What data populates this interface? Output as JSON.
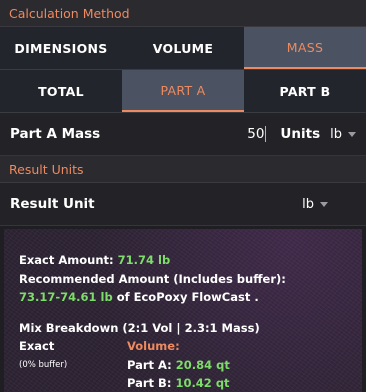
{
  "calc_method": {
    "title": "Calculation Method",
    "tabs": [
      "DIMENSIONS",
      "VOLUME",
      "MASS"
    ],
    "active_tab": "MASS"
  },
  "part_tabs": {
    "tabs": [
      "TOTAL",
      "PART A",
      "PART B"
    ],
    "active_tab": "PART A"
  },
  "part_a_mass": {
    "label": "Part A Mass",
    "value": "50",
    "units_label": "Units",
    "unit": "lb"
  },
  "result_units": {
    "title": "Result Units",
    "label": "Result Unit",
    "unit": "lb"
  },
  "results": {
    "exact_label": "Exact Amount:",
    "exact_value": "71.74 lb",
    "recommended_label": "Recommended Amount (Includes buffer):",
    "recommended_value": "73.17-74.61 lb",
    "product_text": "of EcoPoxy FlowCast .",
    "mix_title": "Mix Breakdown (2:1 Vol | 2.3:1 Mass)",
    "exact_heading": "Exact",
    "buffer_note": "(0% buffer)",
    "volume_heading": "Volume:",
    "part_a_label": "Part A:",
    "part_a_value": "20.84 qt",
    "part_b_label": "Part B:",
    "part_b_value": "10.42 qt"
  },
  "colors": {
    "accent": "#ee8a5f",
    "highlight": "#7ddc6a",
    "active_tab_bg": "#4b5261"
  }
}
